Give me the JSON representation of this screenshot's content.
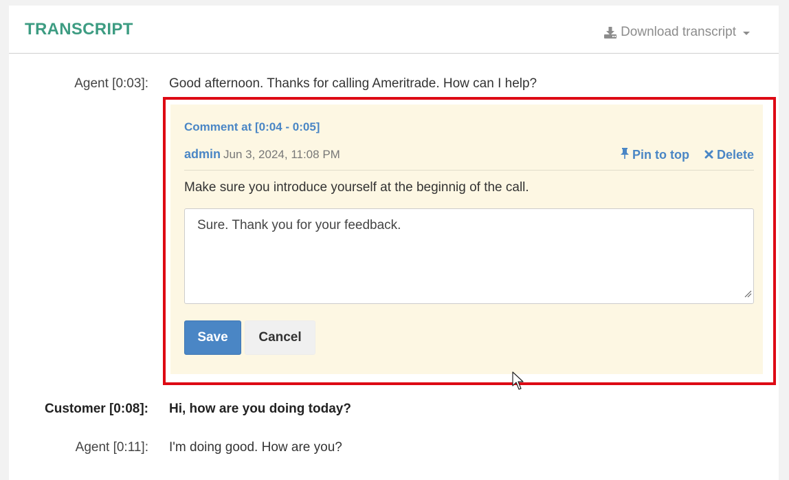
{
  "header": {
    "title": "TRANSCRIPT",
    "download_label": "Download transcript"
  },
  "transcript": [
    {
      "speaker": "Agent [0:03]:",
      "text": "Good afternoon. Thanks for calling Ameritrade. How can I help?",
      "bold": false
    },
    {
      "speaker": "Customer [0:08]:",
      "text": "Hi, how are you doing today?",
      "bold": true
    },
    {
      "speaker": "Agent [0:11]:",
      "text": "I'm doing good. How are you?",
      "bold": false
    }
  ],
  "comment": {
    "title": "Comment at [0:04 - 0:05]",
    "author": "admin",
    "date": "Jun 3, 2024, 11:08 PM",
    "pin_label": "Pin to top",
    "delete_label": "Delete",
    "text": "Make sure you introduce yourself at the beginnig of the call.",
    "reply_value": "Sure. Thank you for your feedback.",
    "save_label": "Save",
    "cancel_label": "Cancel"
  },
  "colors": {
    "accent": "#4a86c5",
    "title": "#3d9c82",
    "highlight_border": "#dd0a14",
    "comment_bg": "#fdf7e3"
  },
  "icons": [
    "download-icon",
    "caret-down-icon",
    "pin-icon",
    "close-icon",
    "resize-handle-icon",
    "mouse-cursor-icon"
  ]
}
